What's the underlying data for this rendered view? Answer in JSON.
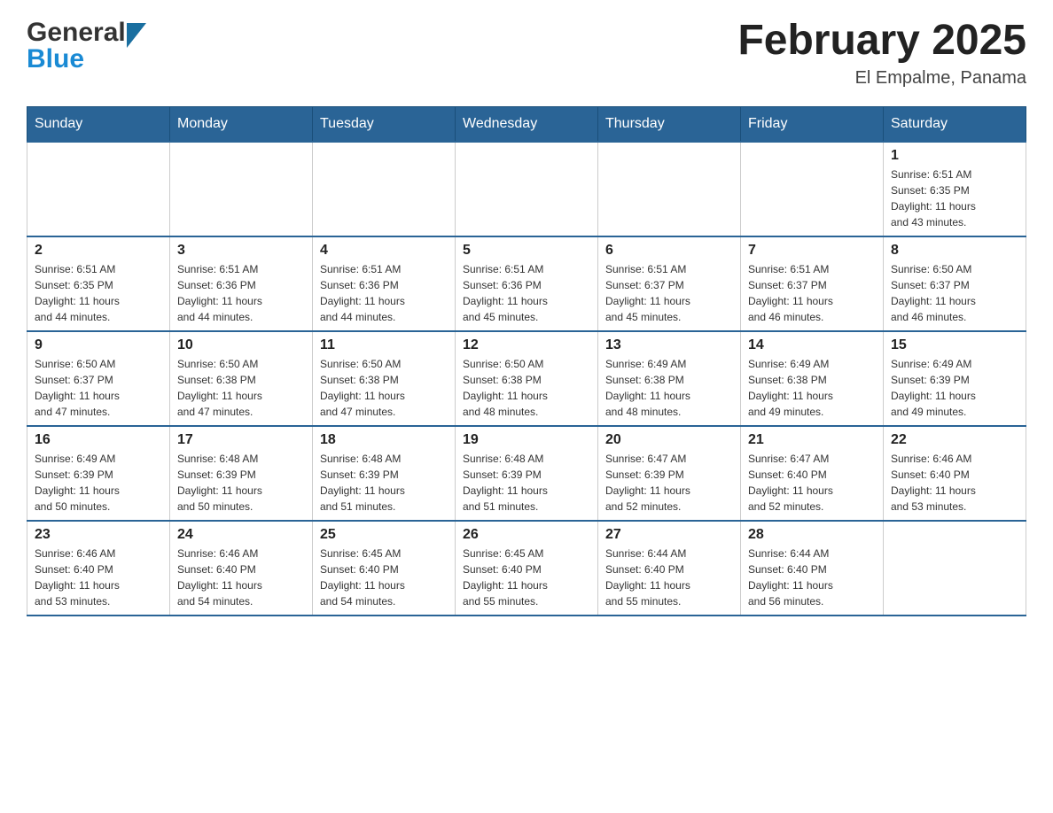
{
  "header": {
    "logo": {
      "general": "General",
      "blue": "Blue"
    },
    "title": "February 2025",
    "subtitle": "El Empalme, Panama"
  },
  "days_of_week": [
    "Sunday",
    "Monday",
    "Tuesday",
    "Wednesday",
    "Thursday",
    "Friday",
    "Saturday"
  ],
  "weeks": [
    [
      {
        "day": "",
        "info": ""
      },
      {
        "day": "",
        "info": ""
      },
      {
        "day": "",
        "info": ""
      },
      {
        "day": "",
        "info": ""
      },
      {
        "day": "",
        "info": ""
      },
      {
        "day": "",
        "info": ""
      },
      {
        "day": "1",
        "info": "Sunrise: 6:51 AM\nSunset: 6:35 PM\nDaylight: 11 hours\nand 43 minutes."
      }
    ],
    [
      {
        "day": "2",
        "info": "Sunrise: 6:51 AM\nSunset: 6:35 PM\nDaylight: 11 hours\nand 44 minutes."
      },
      {
        "day": "3",
        "info": "Sunrise: 6:51 AM\nSunset: 6:36 PM\nDaylight: 11 hours\nand 44 minutes."
      },
      {
        "day": "4",
        "info": "Sunrise: 6:51 AM\nSunset: 6:36 PM\nDaylight: 11 hours\nand 44 minutes."
      },
      {
        "day": "5",
        "info": "Sunrise: 6:51 AM\nSunset: 6:36 PM\nDaylight: 11 hours\nand 45 minutes."
      },
      {
        "day": "6",
        "info": "Sunrise: 6:51 AM\nSunset: 6:37 PM\nDaylight: 11 hours\nand 45 minutes."
      },
      {
        "day": "7",
        "info": "Sunrise: 6:51 AM\nSunset: 6:37 PM\nDaylight: 11 hours\nand 46 minutes."
      },
      {
        "day": "8",
        "info": "Sunrise: 6:50 AM\nSunset: 6:37 PM\nDaylight: 11 hours\nand 46 minutes."
      }
    ],
    [
      {
        "day": "9",
        "info": "Sunrise: 6:50 AM\nSunset: 6:37 PM\nDaylight: 11 hours\nand 47 minutes."
      },
      {
        "day": "10",
        "info": "Sunrise: 6:50 AM\nSunset: 6:38 PM\nDaylight: 11 hours\nand 47 minutes."
      },
      {
        "day": "11",
        "info": "Sunrise: 6:50 AM\nSunset: 6:38 PM\nDaylight: 11 hours\nand 47 minutes."
      },
      {
        "day": "12",
        "info": "Sunrise: 6:50 AM\nSunset: 6:38 PM\nDaylight: 11 hours\nand 48 minutes."
      },
      {
        "day": "13",
        "info": "Sunrise: 6:49 AM\nSunset: 6:38 PM\nDaylight: 11 hours\nand 48 minutes."
      },
      {
        "day": "14",
        "info": "Sunrise: 6:49 AM\nSunset: 6:38 PM\nDaylight: 11 hours\nand 49 minutes."
      },
      {
        "day": "15",
        "info": "Sunrise: 6:49 AM\nSunset: 6:39 PM\nDaylight: 11 hours\nand 49 minutes."
      }
    ],
    [
      {
        "day": "16",
        "info": "Sunrise: 6:49 AM\nSunset: 6:39 PM\nDaylight: 11 hours\nand 50 minutes."
      },
      {
        "day": "17",
        "info": "Sunrise: 6:48 AM\nSunset: 6:39 PM\nDaylight: 11 hours\nand 50 minutes."
      },
      {
        "day": "18",
        "info": "Sunrise: 6:48 AM\nSunset: 6:39 PM\nDaylight: 11 hours\nand 51 minutes."
      },
      {
        "day": "19",
        "info": "Sunrise: 6:48 AM\nSunset: 6:39 PM\nDaylight: 11 hours\nand 51 minutes."
      },
      {
        "day": "20",
        "info": "Sunrise: 6:47 AM\nSunset: 6:39 PM\nDaylight: 11 hours\nand 52 minutes."
      },
      {
        "day": "21",
        "info": "Sunrise: 6:47 AM\nSunset: 6:40 PM\nDaylight: 11 hours\nand 52 minutes."
      },
      {
        "day": "22",
        "info": "Sunrise: 6:46 AM\nSunset: 6:40 PM\nDaylight: 11 hours\nand 53 minutes."
      }
    ],
    [
      {
        "day": "23",
        "info": "Sunrise: 6:46 AM\nSunset: 6:40 PM\nDaylight: 11 hours\nand 53 minutes."
      },
      {
        "day": "24",
        "info": "Sunrise: 6:46 AM\nSunset: 6:40 PM\nDaylight: 11 hours\nand 54 minutes."
      },
      {
        "day": "25",
        "info": "Sunrise: 6:45 AM\nSunset: 6:40 PM\nDaylight: 11 hours\nand 54 minutes."
      },
      {
        "day": "26",
        "info": "Sunrise: 6:45 AM\nSunset: 6:40 PM\nDaylight: 11 hours\nand 55 minutes."
      },
      {
        "day": "27",
        "info": "Sunrise: 6:44 AM\nSunset: 6:40 PM\nDaylight: 11 hours\nand 55 minutes."
      },
      {
        "day": "28",
        "info": "Sunrise: 6:44 AM\nSunset: 6:40 PM\nDaylight: 11 hours\nand 56 minutes."
      },
      {
        "day": "",
        "info": ""
      }
    ]
  ]
}
